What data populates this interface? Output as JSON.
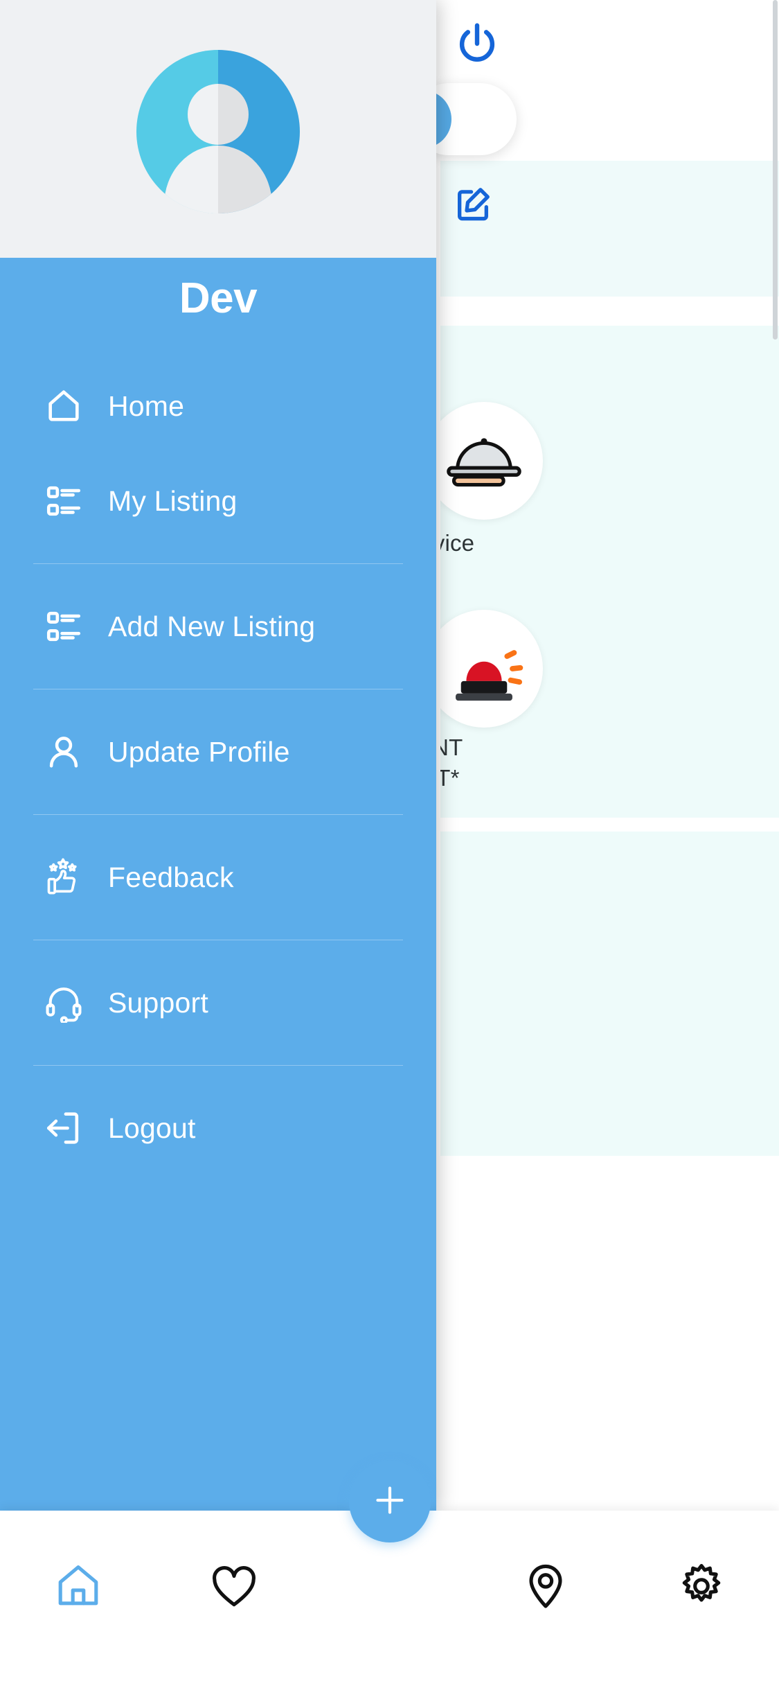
{
  "colors": {
    "drawer_bg": "#5cadea",
    "drawer_header_bg": "#eff1f3",
    "avatar_left": "#55cbe6",
    "avatar_right": "#3aa3dd",
    "avatar_person_left": "#f0f2f4",
    "avatar_person_right": "#e0e1e3",
    "text_on_drawer": "#ffffff",
    "divider": "rgba(255,255,255,0.32)",
    "fab": "#5cadea",
    "nav_active": "#5cadea",
    "nav_inactive": "#111111",
    "bg_accent_blue": "#1565d8",
    "bg_card": "#eefbfa"
  },
  "drawer": {
    "title": "Dev",
    "avatar_icon": "user-avatar-placeholder",
    "items": [
      {
        "id": "home",
        "label": "Home",
        "icon": "home-icon",
        "divider_after": false
      },
      {
        "id": "my-listing",
        "label": "My Listing",
        "icon": "list-icon",
        "divider_after": true
      },
      {
        "id": "add-new-listing",
        "label": "Add New Listing",
        "icon": "list-icon",
        "divider_after": true
      },
      {
        "id": "update-profile",
        "label": "Update Profile",
        "icon": "person-icon",
        "divider_after": true
      },
      {
        "id": "feedback",
        "label": "Feedback",
        "icon": "thumbs-up-stars-icon",
        "divider_after": true
      },
      {
        "id": "support",
        "label": "Support",
        "icon": "headset-icon",
        "divider_after": true
      },
      {
        "id": "logout",
        "label": "Logout",
        "icon": "logout-icon",
        "divider_after": false
      }
    ]
  },
  "background": {
    "power_icon": "power-icon",
    "search_icon": "search-icon",
    "edit_icon": "edit-square-icon",
    "labels": {
      "service": "ervice",
      "important_line1": "TANT",
      "important_line2": "ACT*"
    },
    "thumbs": [
      {
        "id": "service-thumb",
        "icon": "food-dome-icon"
      },
      {
        "id": "alert-thumb",
        "icon": "siren-icon"
      }
    ]
  },
  "bottom_nav": {
    "items": [
      {
        "id": "home",
        "icon": "home-icon",
        "active": true
      },
      {
        "id": "favorites",
        "icon": "heart-icon",
        "active": false
      },
      {
        "id": "location",
        "icon": "map-pin-icon",
        "active": false
      },
      {
        "id": "settings",
        "icon": "gear-icon",
        "active": false
      }
    ],
    "fab": {
      "id": "add-fab",
      "icon": "plus-icon",
      "label": "+"
    }
  }
}
